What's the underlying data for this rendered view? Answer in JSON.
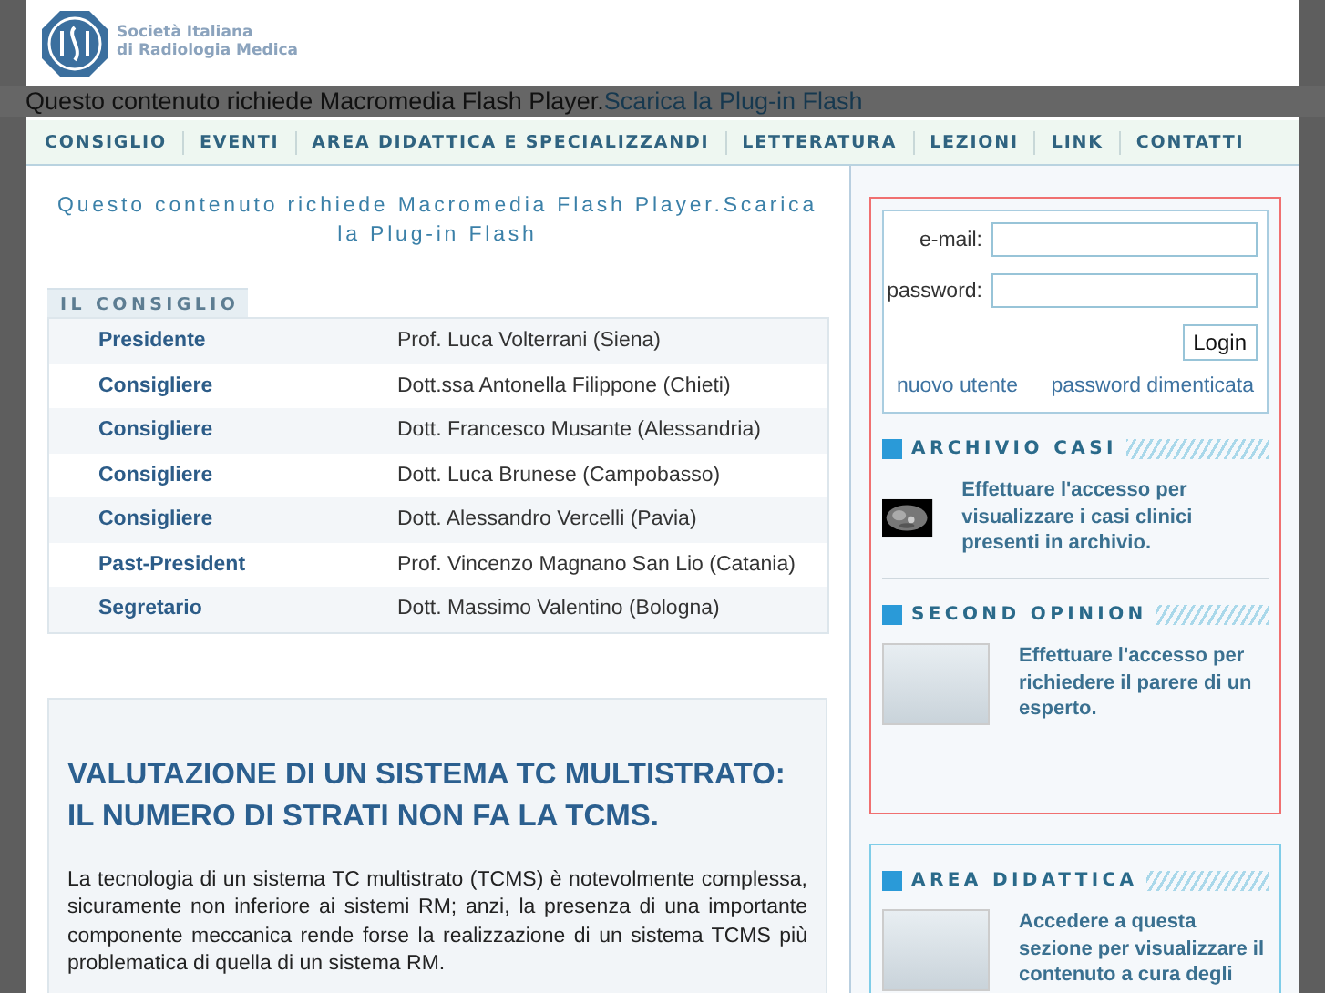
{
  "header": {
    "org_name_line1": "Società Italiana",
    "org_name_line2": "di Radiologia Medica"
  },
  "flash_bar": {
    "message": "Questo contenuto richiede Macromedia Flash Player.",
    "link": "Scarica la Plug-in Flash"
  },
  "nav": [
    "CONSIGLIO",
    "EVENTI",
    "AREA DIDATTICA E SPECIALIZZANDI",
    "LETTERATURA",
    "LEZIONI",
    "LINK",
    "CONTATTI"
  ],
  "flash_notice": "Questo contenuto richiede Macromedia Flash Player.Scarica la Plug-in Flash",
  "council": {
    "title": "IL CONSIGLIO",
    "rows": [
      {
        "role": "Presidente",
        "name": "Prof. Luca Volterrani (Siena)"
      },
      {
        "role": "Consigliere",
        "name": "Dott.ssa Antonella Filippone (Chieti)"
      },
      {
        "role": "Consigliere",
        "name": "Dott. Francesco Musante (Alessandria)"
      },
      {
        "role": "Consigliere",
        "name": "Dott. Luca Brunese (Campobasso)"
      },
      {
        "role": "Consigliere",
        "name": "Dott. Alessandro Vercelli (Pavia)"
      },
      {
        "role": "Past-President",
        "name": "Prof. Vincenzo Magnano San Lio (Catania)"
      },
      {
        "role": "Segretario",
        "name": "Dott. Massimo Valentino (Bologna)"
      }
    ]
  },
  "article": {
    "title": "VALUTAZIONE DI UN SISTEMA TC MULTISTRATO: IL NUMERO DI STRATI NON FA LA TCMS.",
    "paragraphs": [
      "La tecnologia di un sistema TC multistrato (TCMS) è notevolmente complessa, sicuramente non inferiore ai sistemi RM; anzi, la presenza di una importante componente meccanica rende forse la realizzazione di un sistema TCMS più problematica di quella di un sistema RM."
    ]
  },
  "login": {
    "email_label": "e-mail:",
    "password_label": "password:",
    "button": "Login",
    "new_user_link": "nuovo utente",
    "forgot_link": "password dimenticata"
  },
  "sections": [
    {
      "title": "ARCHIVIO CASI",
      "kind": "scan",
      "text": "Effettuare l'accesso per visualizzare i casi clinici presenti in archivio."
    },
    {
      "title": "SECOND OPINION",
      "kind": "photo",
      "text": "Effettuare l'accesso per richiedere il parere di un esperto."
    },
    {
      "title": "AREA DIDATTICA",
      "kind": "photo",
      "text": "Accedere a questa sezione per visualizzare il contenuto a cura degli"
    }
  ]
}
